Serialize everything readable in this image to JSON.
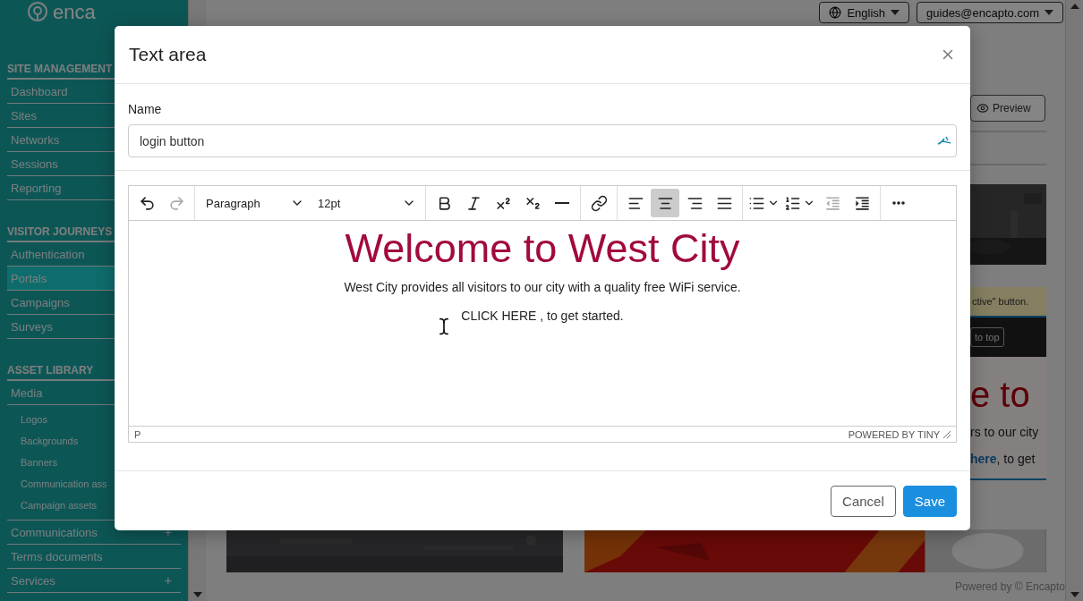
{
  "sidebar": {
    "logo": "enca",
    "sections": [
      {
        "title": "SITE MANAGEMENT",
        "items": [
          {
            "label": "Dashboard",
            "selected": false
          },
          {
            "label": "Sites",
            "selected": false
          },
          {
            "label": "Networks",
            "selected": false
          },
          {
            "label": "Sessions",
            "selected": false
          },
          {
            "label": "Reporting",
            "selected": false
          }
        ]
      },
      {
        "title": "VISITOR JOURNEYS",
        "items": [
          {
            "label": "Authentication",
            "selected": false
          },
          {
            "label": "Portals",
            "selected": true
          },
          {
            "label": "Campaigns",
            "selected": false
          },
          {
            "label": "Surveys",
            "selected": false
          }
        ]
      },
      {
        "title": "ASSET LIBRARY",
        "items": [
          {
            "label": "Media",
            "selected": false,
            "children": [
              {
                "label": "Logos",
                "selected": false
              },
              {
                "label": "Backgrounds",
                "selected": false
              },
              {
                "label": "Banners",
                "selected": false
              },
              {
                "label": "Communication ass",
                "selected": false
              },
              {
                "label": "Campaign assets",
                "selected": false
              }
            ]
          },
          {
            "label": "Communications",
            "selected": false,
            "toggle": "+"
          },
          {
            "label": "Terms documents",
            "selected": false
          },
          {
            "label": "Services",
            "selected": false,
            "toggle": "+"
          }
        ]
      }
    ]
  },
  "header": {
    "language": "English",
    "account": "guides@encapto.com"
  },
  "preview": {
    "button": "Preview",
    "notice": "ctive\" button.",
    "back_to_top": "to top",
    "heading": "e to",
    "line_1": "rs to our city",
    "line_2": "**here**, to get"
  },
  "footer": "Powered by © Encapto",
  "modal": {
    "title": "Text area",
    "name_label": "Name",
    "name_value": "login button",
    "toolbar": [
      [
        {
          "kind": "undo",
          "selected": false,
          "disabled": false
        },
        {
          "kind": "redo",
          "selected": false,
          "disabled": true
        }
      ],
      [
        {
          "kind": "select",
          "label": "Paragraph"
        },
        {
          "kind": "select",
          "label": "12pt"
        }
      ],
      [
        {
          "kind": "bold",
          "selected": false,
          "disabled": false
        },
        {
          "kind": "italic",
          "selected": false,
          "disabled": false
        },
        {
          "kind": "superscript",
          "selected": false,
          "disabled": false
        },
        {
          "kind": "subscript",
          "selected": false,
          "disabled": false
        },
        {
          "kind": "rule",
          "selected": false,
          "disabled": false
        }
      ],
      [
        {
          "kind": "link",
          "selected": false,
          "disabled": false
        }
      ],
      [
        {
          "kind": "align-left",
          "selected": false,
          "disabled": false
        },
        {
          "kind": "align-center",
          "selected": true,
          "disabled": false
        },
        {
          "kind": "align-right",
          "selected": false,
          "disabled": false
        },
        {
          "kind": "justify",
          "selected": false,
          "disabled": false
        }
      ],
      [
        {
          "kind": "bullet-list",
          "selected": false,
          "disabled": false
        },
        {
          "kind": "numbered-list",
          "selected": false,
          "disabled": false
        },
        {
          "kind": "outdent",
          "selected": false,
          "disabled": true
        },
        {
          "kind": "indent",
          "selected": false,
          "disabled": false
        }
      ],
      [
        {
          "kind": "more",
          "selected": false,
          "disabled": false
        }
      ]
    ],
    "content": {
      "heading": "Welcome to West City",
      "paragraph": "West City provides all visitors to our city with a quality free WiFi service.",
      "call": "CLICK HERE , to get started."
    },
    "status_path": "P",
    "branding": "POWERED BY TINY",
    "buttons": [
      {
        "label": "Cancel",
        "kind": "secondary"
      },
      {
        "label": "Save",
        "kind": "primary"
      }
    ]
  }
}
